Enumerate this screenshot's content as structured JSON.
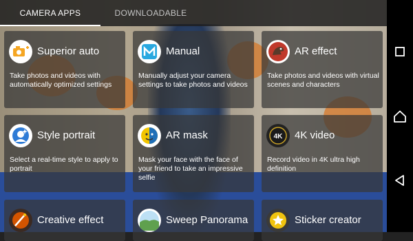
{
  "tabs": [
    {
      "label": "CAMERA APPS",
      "active": true
    },
    {
      "label": "DOWNLOADABLE",
      "active": false
    }
  ],
  "apps": [
    {
      "title": "Superior auto",
      "description": "Take photos and videos with automatically optimized settings",
      "icon": "camera-plus-icon",
      "icon_color": "#f5a623"
    },
    {
      "title": "Manual",
      "description": "Manually adjust your camera settings to take photos and videos",
      "icon": "letter-m-icon",
      "icon_color": "#29a8e0"
    },
    {
      "title": "AR effect",
      "description": "Take photos and videos with virtual scenes and characters",
      "icon": "dinosaur-icon",
      "icon_color": "#c0392b"
    },
    {
      "title": "Style portrait",
      "description": "Select a real-time style to apply to portrait",
      "icon": "portrait-face-icon",
      "icon_color": "#2e7bd6"
    },
    {
      "title": "AR mask",
      "description": "Mask your face with the face of your friend to take an impressive selfie",
      "icon": "mask-face-icon",
      "icon_color": "#f2c500"
    },
    {
      "title": "4K video",
      "description": "Record video in 4K ultra high definition",
      "icon": "4k-icon",
      "icon_color": "#222222"
    },
    {
      "title": "Creative effect",
      "description": "",
      "icon": "creative-effect-icon",
      "icon_color": "#d35400"
    },
    {
      "title": "Sweep Panorama",
      "description": "",
      "icon": "panorama-landscape-icon",
      "icon_color": "#5fa04e"
    },
    {
      "title": "Sticker creator",
      "description": "",
      "icon": "star-sticker-icon",
      "icon_color": "#f1c40f"
    }
  ],
  "navbar": {
    "buttons": [
      {
        "name": "recents",
        "icon": "square-icon"
      },
      {
        "name": "home",
        "icon": "home-icon"
      },
      {
        "name": "back",
        "icon": "back-triangle-icon"
      }
    ]
  }
}
